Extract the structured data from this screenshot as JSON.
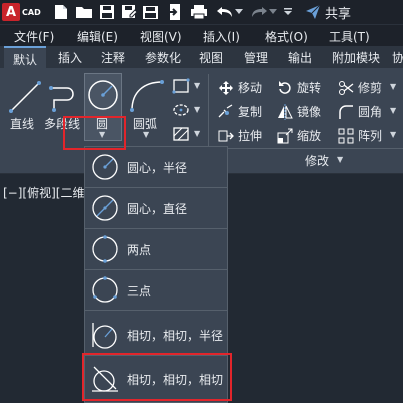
{
  "app": {
    "logo_letter": "A",
    "logo_text": "CAD",
    "share_label": "共享"
  },
  "menu": [
    {
      "label": "文件(F)"
    },
    {
      "label": "编辑(E)"
    },
    {
      "label": "视图(V)"
    },
    {
      "label": "插入(I)"
    },
    {
      "label": "格式(O)"
    },
    {
      "label": "工具(T)"
    }
  ],
  "tabs": [
    {
      "label": "默认"
    },
    {
      "label": "插入"
    },
    {
      "label": "注释"
    },
    {
      "label": "参数化"
    },
    {
      "label": "视图"
    },
    {
      "label": "管理"
    },
    {
      "label": "输出"
    },
    {
      "label": "附加模块"
    },
    {
      "label": "协"
    }
  ],
  "draw": {
    "line": "直线",
    "polyline": "多段线",
    "circle": "圆",
    "arc": "圆弧"
  },
  "modify": {
    "move": "移动",
    "rotate": "旋转",
    "trim": "修剪",
    "copy": "复制",
    "mirror": "镜像",
    "fillet": "圆角",
    "stretch": "拉伸",
    "scale": "缩放",
    "array": "阵列",
    "panel_title": "修改"
  },
  "viewport": {
    "label": "[−][俯视][二维"
  },
  "circle_menu": [
    {
      "label": "圆心，半径",
      "icon": "circle-center-radius-icon"
    },
    {
      "label": "圆心，直径",
      "icon": "circle-center-diameter-icon"
    },
    {
      "label": "两点",
      "icon": "circle-two-point-icon"
    },
    {
      "label": "三点",
      "icon": "circle-three-point-icon"
    },
    {
      "label": "相切，相切，半径",
      "icon": "circle-tan-tan-radius-icon"
    },
    {
      "label": "相切，相切，相切",
      "icon": "circle-tan-tan-tan-icon"
    }
  ]
}
